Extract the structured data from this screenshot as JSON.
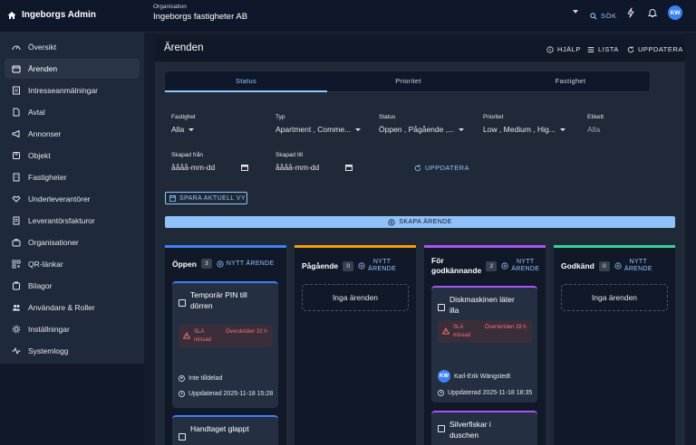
{
  "app": {
    "brand": "Ingeborgs Admin"
  },
  "org": {
    "label": "Organisation",
    "value": "Ingeborgs fastigheter AB"
  },
  "topbar": {
    "search_label": "SÖK",
    "avatar_initials": "KW"
  },
  "sidebar": {
    "items": [
      {
        "label": "Översikt",
        "icon": "dashboard-icon"
      },
      {
        "label": "Ärenden",
        "icon": "tickets-icon",
        "active": true
      },
      {
        "label": "Intresseanmälningar",
        "icon": "form-icon"
      },
      {
        "label": "Avtal",
        "icon": "document-icon"
      },
      {
        "label": "Annonser",
        "icon": "megaphone-icon"
      },
      {
        "label": "Objekt",
        "icon": "box-icon"
      },
      {
        "label": "Fastigheter",
        "icon": "building-icon"
      },
      {
        "label": "Underleverantörer",
        "icon": "handshake-icon"
      },
      {
        "label": "Leverantörsfakturor",
        "icon": "invoice-icon"
      },
      {
        "label": "Organisationer",
        "icon": "briefcase-icon"
      },
      {
        "label": "QR-länkar",
        "icon": "qr-icon"
      },
      {
        "label": "Bilagor",
        "icon": "attachment-icon"
      },
      {
        "label": "Användare & Roller",
        "icon": "users-icon"
      },
      {
        "label": "Inställningar",
        "icon": "settings-icon"
      },
      {
        "label": "Systemlogg",
        "icon": "log-icon"
      }
    ]
  },
  "page": {
    "title": "Ärenden",
    "help_label": "HJÄLP",
    "list_label": "LISTA",
    "update_label": "UPPDATERA"
  },
  "tabs": [
    {
      "label": "Status",
      "active": true
    },
    {
      "label": "Prioritet"
    },
    {
      "label": "Fastighet"
    }
  ],
  "filters": {
    "fastighet": {
      "label": "Fastighet",
      "value": "Alla"
    },
    "typ": {
      "label": "Typ",
      "value": "Apartment , Comme..."
    },
    "status": {
      "label": "Status",
      "value": "Öppen , Pågående ,..."
    },
    "prioritet": {
      "label": "Prioritet",
      "value": "Low , Medium , Hig..."
    },
    "etikett": {
      "label": "Etikett",
      "placeholder": "Alla"
    },
    "skapad_fran": {
      "label": "Skapad från",
      "value": "åååå-mm-dd"
    },
    "skapad_till": {
      "label": "Skapad till",
      "value": "åååå-mm-dd"
    },
    "update_label": "UPPDATERA"
  },
  "actions": {
    "save_view": "SPARA AKTUELL VY",
    "create": "SKAPA ÄRENDE"
  },
  "new_label": "NYTT ÄRENDE",
  "new_label_line1": "NYTT",
  "new_label_line2": "ÄRENDE",
  "empty_label": "Inga ärenden",
  "columns": {
    "open": {
      "title": "Öppen",
      "count": "3",
      "color": "#3b82f6",
      "cards": [
        {
          "title": "Temporär PIN till dörren",
          "sla_missed": "SLA missad",
          "sla_overdue": "Överskriden 32 h",
          "assignee": "Inte tilldelad",
          "updated": "Uppdaterad 2025-11-18 15:28"
        },
        {
          "title": "Handtaget glappt"
        }
      ]
    },
    "ongoing": {
      "title": "Pågående",
      "count": "0",
      "color": "#f59e0b"
    },
    "approval": {
      "title_line1": "För",
      "title_line2": "godkännande",
      "count": "2",
      "color": "#a855f7",
      "cards": [
        {
          "title": "Diskmaskinen läter illa",
          "sla_missed": "SLA missad",
          "sla_overdue": "Överskriden 28 h",
          "assignee_initials": "KW",
          "assignee": "Karl-Erik Wängstedt",
          "updated": "Uppdaterad 2025-11-18 18:35"
        },
        {
          "title": "Silverfiskar i duschen"
        }
      ]
    },
    "approved": {
      "title": "Godkänd",
      "count": "0",
      "color": "#34d399"
    }
  }
}
